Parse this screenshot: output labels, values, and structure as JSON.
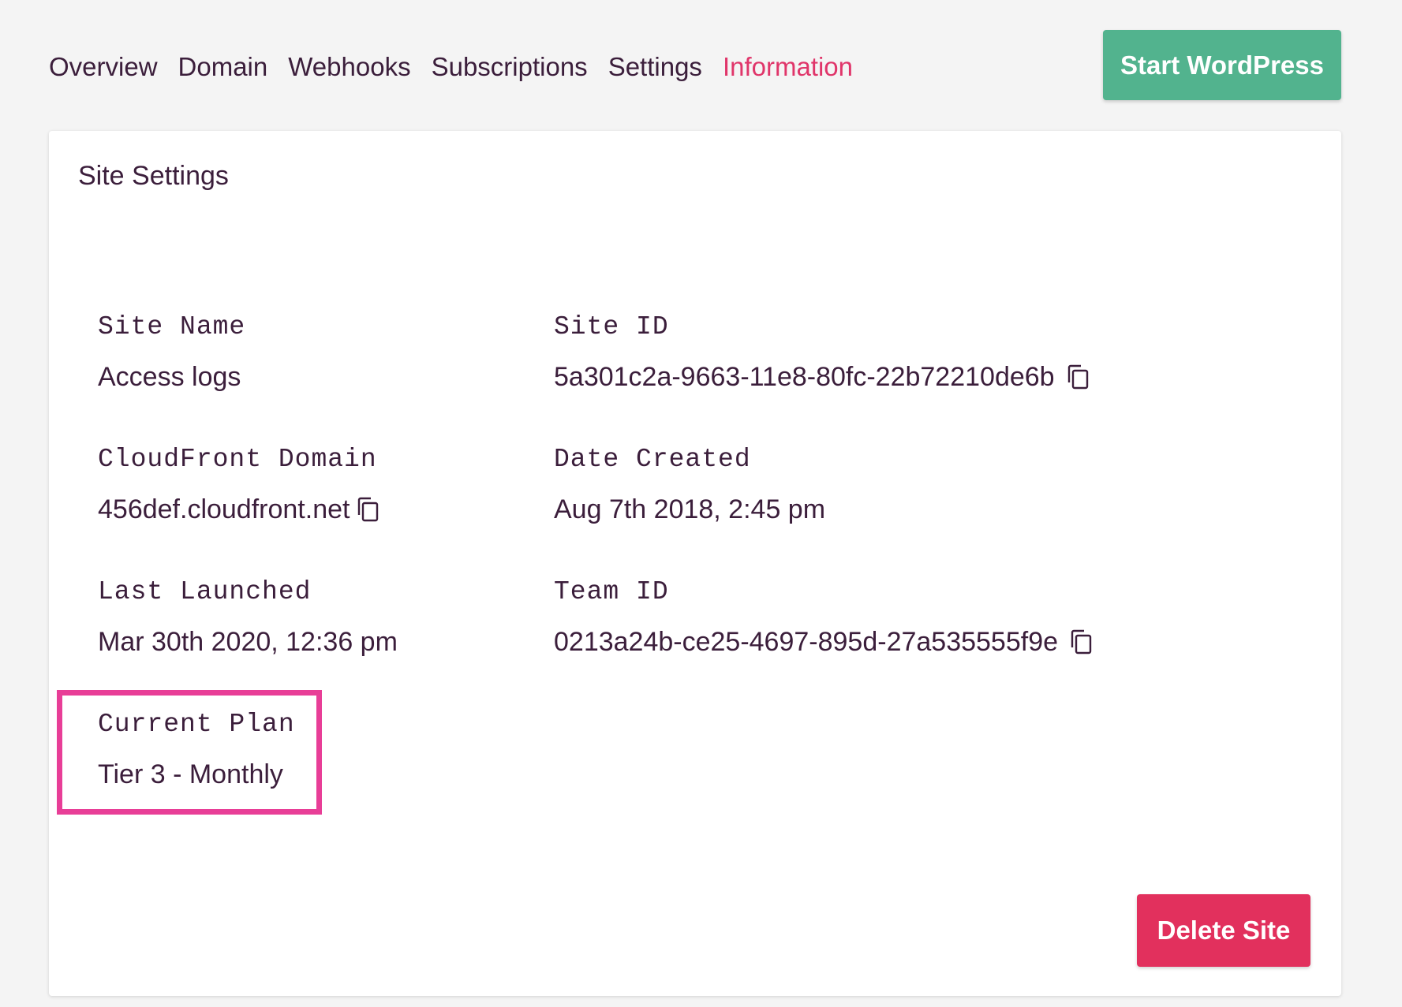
{
  "nav": {
    "tabs": [
      {
        "label": "Overview",
        "active": false
      },
      {
        "label": "Domain",
        "active": false
      },
      {
        "label": "Webhooks",
        "active": false
      },
      {
        "label": "Subscriptions",
        "active": false
      },
      {
        "label": "Settings",
        "active": false
      },
      {
        "label": "Information",
        "active": true
      }
    ],
    "start_button": "Start WordPress"
  },
  "card": {
    "title": "Site Settings",
    "fields": {
      "site_name": {
        "label": "Site Name",
        "value": "Access logs"
      },
      "site_id": {
        "label": "Site ID",
        "value": "5a301c2a-9663-11e8-80fc-22b72210de6b"
      },
      "cloudfront_domain": {
        "label": "CloudFront Domain",
        "value": "456def.cloudfront.net"
      },
      "date_created": {
        "label": "Date Created",
        "value": "Aug 7th 2018, 2:45 pm"
      },
      "last_launched": {
        "label": "Last Launched",
        "value": "Mar 30th 2020, 12:36 pm"
      },
      "team_id": {
        "label": "Team ID",
        "value": "0213a24b-ce25-4697-895d-27a535555f9e"
      },
      "current_plan": {
        "label": "Current Plan",
        "value": "Tier 3 - Monthly"
      }
    },
    "delete_button": "Delete Site"
  },
  "icons": {
    "copy": "copy-icon"
  },
  "colors": {
    "active_tab": "#e0356a",
    "primary_button": "#52b38e",
    "danger_button": "#e2305d",
    "highlight": "#e83e97",
    "text": "#3b1e3b",
    "background": "#f4f4f4"
  }
}
